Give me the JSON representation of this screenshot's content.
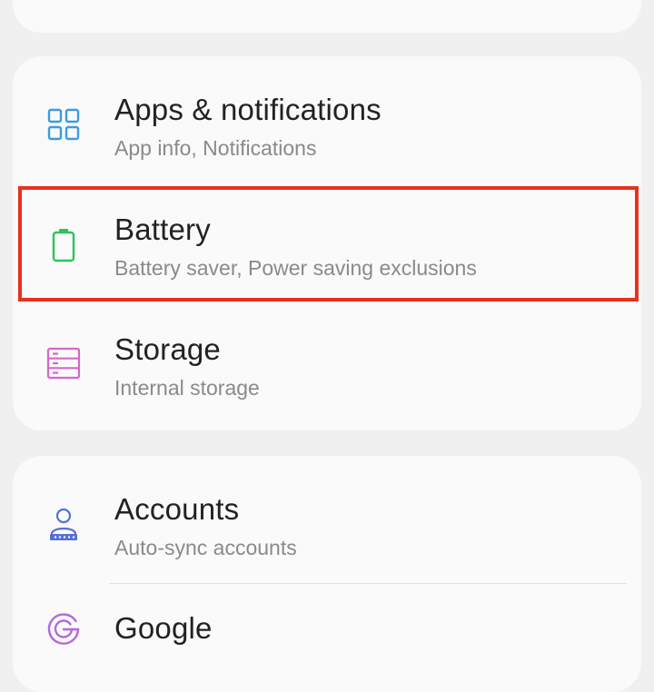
{
  "settings": {
    "group1": [
      {
        "title": "Apps & notifications",
        "subtitle": "App info, Notifications",
        "icon": "apps-grid-icon",
        "color": "#3d9be0"
      },
      {
        "title": "Battery",
        "subtitle": "Battery saver, Power saving exclusions",
        "icon": "battery-icon",
        "color": "#2cc45a"
      },
      {
        "title": "Storage",
        "subtitle": "Internal storage",
        "icon": "storage-icon",
        "color": "#d866c8"
      }
    ],
    "group2": [
      {
        "title": "Accounts",
        "subtitle": "Auto-sync accounts",
        "icon": "account-icon",
        "color": "#5570d8"
      },
      {
        "title": "Google",
        "subtitle": "",
        "icon": "google-icon",
        "color": "#b46ad8"
      }
    ]
  },
  "highlight": {
    "target": "Battery",
    "color": "#e8301c"
  }
}
